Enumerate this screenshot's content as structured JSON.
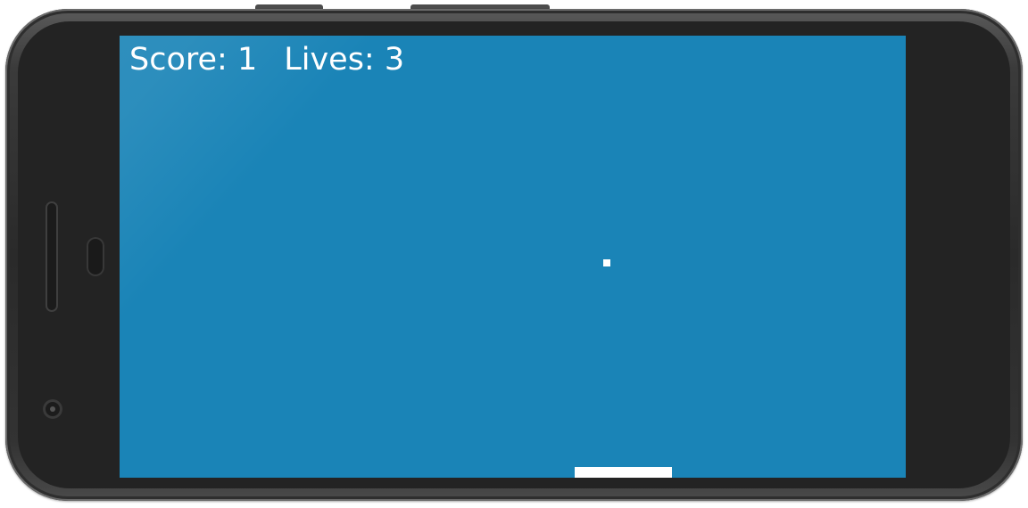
{
  "hud": {
    "score_label": "Score: 1",
    "lives_label": "Lives: 3"
  },
  "game": {
    "score": 1,
    "lives": 3
  },
  "colors": {
    "background": "#1a84b7",
    "ball": "#ffffff",
    "paddle": "#ffffff",
    "text": "#ffffff",
    "device_frame": "#2a2a2a"
  }
}
